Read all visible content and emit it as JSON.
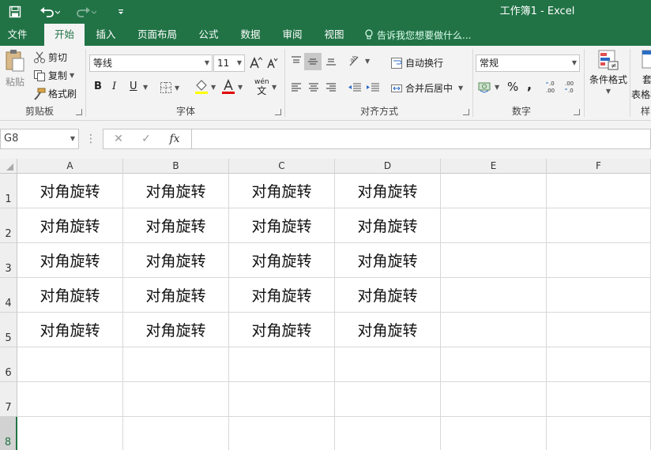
{
  "app": {
    "title": "工作簿1 - Excel"
  },
  "tabs": [
    {
      "label": "文件"
    },
    {
      "label": "开始"
    },
    {
      "label": "插入"
    },
    {
      "label": "页面布局"
    },
    {
      "label": "公式"
    },
    {
      "label": "数据"
    },
    {
      "label": "审阅"
    },
    {
      "label": "视图"
    }
  ],
  "active_tab": "开始",
  "tell_me": "告诉我您想要做什么...",
  "ribbon": {
    "clipboard": {
      "paste": "粘贴",
      "cut": "剪切",
      "copy": "复制",
      "format_painter": "格式刷",
      "label": "剪贴板"
    },
    "font": {
      "font_name": "等线",
      "font_size": "11",
      "bold": "B",
      "italic": "I",
      "underline": "U",
      "label": "字体",
      "pinyin_glyph": "wén",
      "font_color": "#e00000",
      "fill_color": "#ffff00"
    },
    "alignment": {
      "wrap_text": "自动换行",
      "merge_center": "合并后居中",
      "label": "对齐方式"
    },
    "number": {
      "format": "常规",
      "percent": "%",
      "comma": ",",
      "label": "数字"
    },
    "styles": {
      "conditional_format": "条件格式",
      "table_format_partial": "套",
      "table_format_partial_2": "表格格",
      "label_partial": "样"
    }
  },
  "formula_bar": {
    "name_box": "G8",
    "cancel": "✕",
    "enter": "✓",
    "fx": "fx",
    "value": ""
  },
  "sheet": {
    "columns": [
      "A",
      "B",
      "C",
      "D",
      "E",
      "F"
    ],
    "rows": [
      "1",
      "2",
      "3",
      "4",
      "5",
      "6",
      "7",
      "8"
    ],
    "selected_row": "8",
    "cells": [
      [
        "对角旋转",
        "对角旋转",
        "对角旋转",
        "对角旋转",
        "",
        ""
      ],
      [
        "对角旋转",
        "对角旋转",
        "对角旋转",
        "对角旋转",
        "",
        ""
      ],
      [
        "对角旋转",
        "对角旋转",
        "对角旋转",
        "对角旋转",
        "",
        ""
      ],
      [
        "对角旋转",
        "对角旋转",
        "对角旋转",
        "对角旋转",
        "",
        ""
      ],
      [
        "对角旋转",
        "对角旋转",
        "对角旋转",
        "对角旋转",
        "",
        ""
      ],
      [
        "",
        "",
        "",
        "",
        "",
        ""
      ],
      [
        "",
        "",
        "",
        "",
        "",
        ""
      ],
      [
        "",
        "",
        "",
        "",
        "",
        ""
      ]
    ]
  },
  "colors": {
    "accent": "#217346"
  }
}
